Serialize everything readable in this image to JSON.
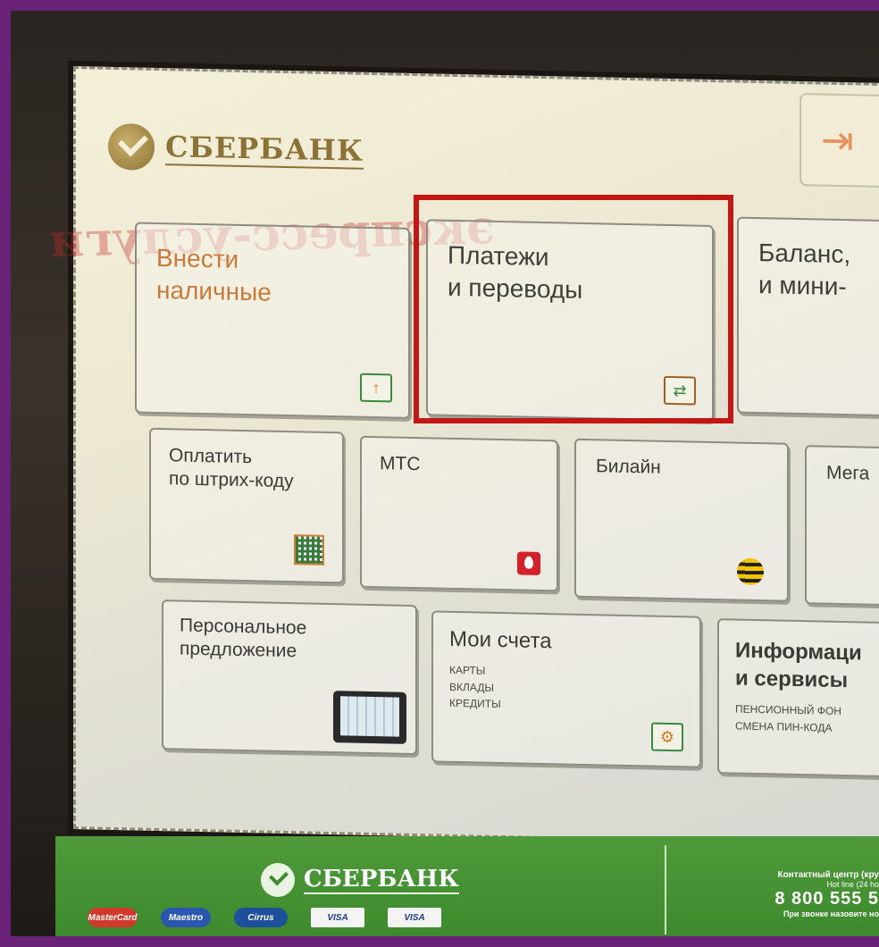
{
  "bank": {
    "name": "СБЕРБАНК"
  },
  "exit": {
    "icon": "exit-icon"
  },
  "tiles": {
    "deposit": {
      "line1": "Внести",
      "line2": "наличные",
      "icon": "cash-in-icon"
    },
    "payments": {
      "line1": "Платежи",
      "line2": "и переводы",
      "icon": "transfer-icon"
    },
    "balance": {
      "line1": "Баланс,",
      "line2": "и мини-"
    },
    "barcode": {
      "line1": "Оплатить",
      "line2": "по штрих-коду",
      "icon": "qr-code-icon"
    },
    "mts": {
      "label": "МТС",
      "icon": "mts-logo-icon"
    },
    "beeline": {
      "label": "Билайн",
      "icon": "beeline-logo-icon"
    },
    "megafon": {
      "label": "Мега"
    },
    "personal": {
      "line1": "Персональное",
      "line2": "предложение",
      "icon": "tablet-icon"
    },
    "accounts": {
      "title": "Мои счета",
      "sub1": "КАРТЫ",
      "sub2": "ВКЛАДЫ",
      "sub3": "КРЕДИТЫ",
      "icon": "safe-icon"
    },
    "info": {
      "line1": "Информаци",
      "line2": "и сервисы",
      "sub1": "ПЕНСИОННЫЙ ФОН",
      "sub2": "СМЕНА ПИН-КОДА"
    }
  },
  "panel": {
    "bank_name": "СБЕРБАНК",
    "cards": [
      "MasterCard",
      "Maestro",
      "Cirrus",
      "VISA",
      "VISA"
    ],
    "contact_title": "Контактный центр (кру",
    "hotline": "Hot line (24 ho",
    "phone": "8 800 555 5",
    "note": "При звонке назовите но"
  },
  "colors": {
    "frame": "#6a2279",
    "highlight": "#c51616",
    "brand": "#8c7236",
    "panel": "#3d8a2e"
  }
}
